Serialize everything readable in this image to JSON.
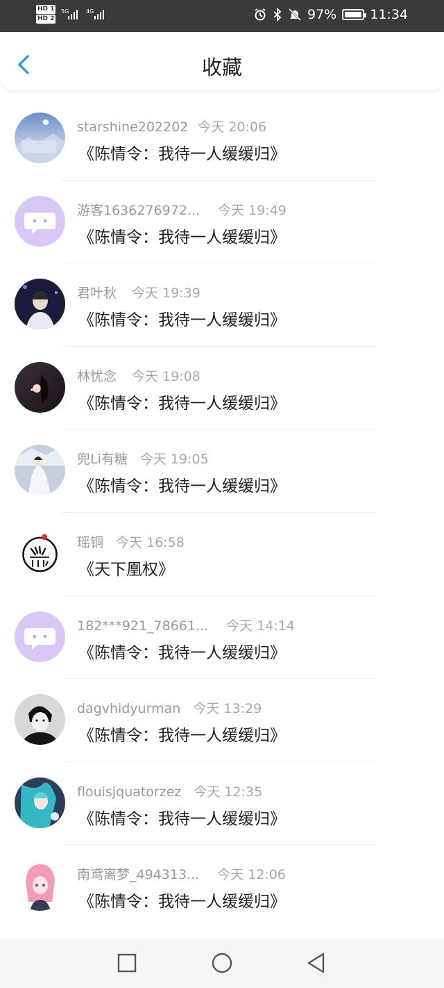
{
  "status_bar": {
    "hd1": "HD 1",
    "hd2": "HD 2",
    "sig1": "5G",
    "sig2": "4G",
    "battery": "97%",
    "time": "11:34"
  },
  "header": {
    "title": "收藏"
  },
  "favorites": [
    {
      "user": "starshine202202",
      "time": "今天 20:06",
      "book": "《陈情令：我待一人缓缓归》",
      "avatar": "avatar-snowy-city"
    },
    {
      "user": "游客1636276972...",
      "time": "今天 19:49",
      "book": "《陈情令：我待一人缓缓归》",
      "avatar": "avatar-default-chat"
    },
    {
      "user": "君叶秋",
      "time": "今天 19:39",
      "book": "《陈情令：我待一人缓缓归》",
      "avatar": "avatar-portrait-dark"
    },
    {
      "user": "林忧念",
      "time": "今天 19:08",
      "book": "《陈情令：我待一人缓缓归》",
      "avatar": "avatar-silhouette"
    },
    {
      "user": "兜Li有糖",
      "time": "今天 19:05",
      "book": "《陈情令：我待一人缓缓归》",
      "avatar": "avatar-white-figure"
    },
    {
      "user": "瑶铜",
      "time": "今天 16:58",
      "book": "《天下凰权》",
      "avatar": "avatar-logo"
    },
    {
      "user": "182***921_78661...",
      "time": "今天 14:14",
      "book": "《陈情令：我待一人缓缓归》",
      "avatar": "avatar-default-chat"
    },
    {
      "user": "dagvhidyurman",
      "time": "今天 13:29",
      "book": "《陈情令：我待一人缓缓归》",
      "avatar": "avatar-bw-photo"
    },
    {
      "user": "flouisjquatorzez",
      "time": "今天 12:35",
      "book": "《陈情令：我待一人缓缓归》",
      "avatar": "avatar-anime-teal"
    },
    {
      "user": "南鸢离梦_494313...",
      "time": "今天 12:06",
      "book": "《陈情令：我待一人缓缓归》",
      "avatar": "avatar-anime-pink"
    }
  ],
  "colors": {
    "accent": "#2b9cf2",
    "default_avatar": "#d9c8f5",
    "meta_text": "#9a9a9a",
    "title_text": "#222222"
  }
}
